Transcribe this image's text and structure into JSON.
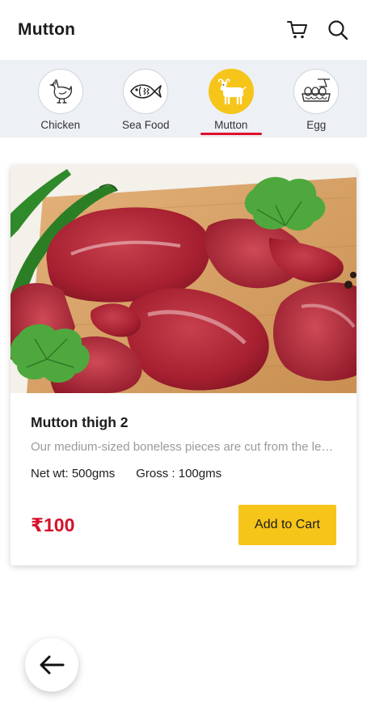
{
  "header": {
    "title": "Mutton",
    "cart_icon": "cart-icon",
    "search_icon": "search-icon"
  },
  "categories": [
    {
      "label": "Chicken",
      "icon": "chicken-icon",
      "active": false
    },
    {
      "label": "Sea Food",
      "icon": "fish-icon",
      "active": false
    },
    {
      "label": "Mutton",
      "icon": "goat-icon",
      "active": true
    },
    {
      "label": "Egg",
      "icon": "egg-icon",
      "active": false
    }
  ],
  "product": {
    "name": "Mutton thigh 2",
    "description": "Our medium-sized boneless pieces are cut from the leg and shoulder",
    "net_wt": "Net wt: 500gms",
    "gross": "Gross : 100gms",
    "price": "₹100",
    "add_to_cart_label": "Add to Cart"
  },
  "colors": {
    "accent_yellow": "#f6c51a",
    "price_red": "#d5122b",
    "active_underline": "#e0102f"
  }
}
